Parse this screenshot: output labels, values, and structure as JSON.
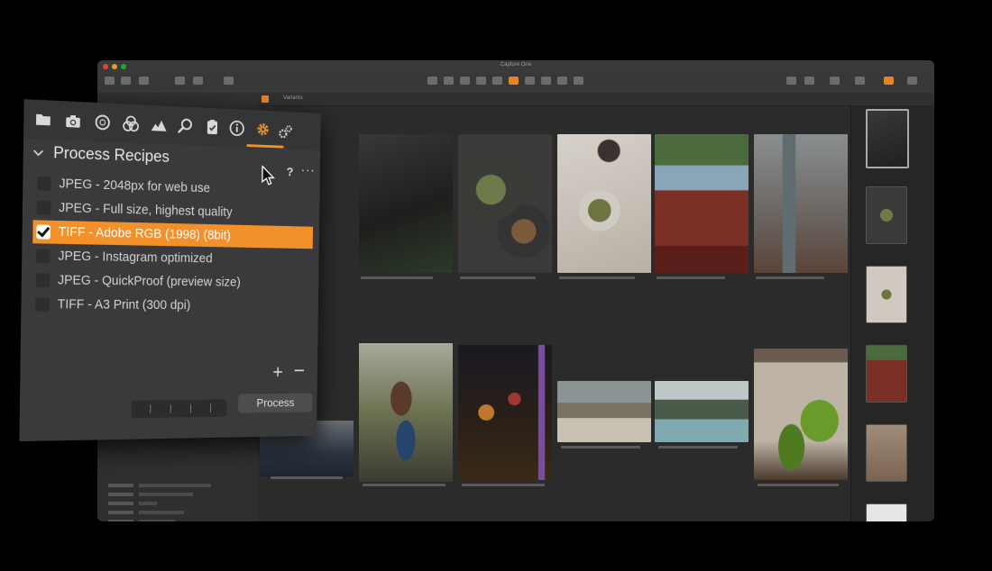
{
  "app": {
    "window_title": "Capture One",
    "variant_label": "Variants",
    "colors": {
      "accent": "#f2902a",
      "panel_bg": "#3a3a3c",
      "window_bg": "#2b2b2b"
    }
  },
  "toolbar_icons": [
    "folder-icon",
    "camera-icon",
    "circle-icon",
    "color-icon",
    "exposure-icon",
    "details-icon",
    "clipboard-icon",
    "info-icon",
    "output-gear-icon",
    "batch-gears-icon"
  ],
  "panel": {
    "section_title": "Process Recipes",
    "help_label": "?",
    "more_label": "···",
    "add_label": "+",
    "remove_label": "−",
    "process_label": "Process",
    "recipes": [
      {
        "label": "JPEG - 2048px for web use",
        "checked": false
      },
      {
        "label": "JPEG - Full size, highest quality",
        "checked": false
      },
      {
        "label": "TIFF - Adobe RGB (1998) (8bit)",
        "checked": true
      },
      {
        "label": "JPEG - Instagram optimized",
        "checked": false
      },
      {
        "label": "JPEG - QuickProof (preview size)",
        "checked": false
      },
      {
        "label": "TIFF - A3 Print (300 dpi)",
        "checked": false
      }
    ]
  }
}
